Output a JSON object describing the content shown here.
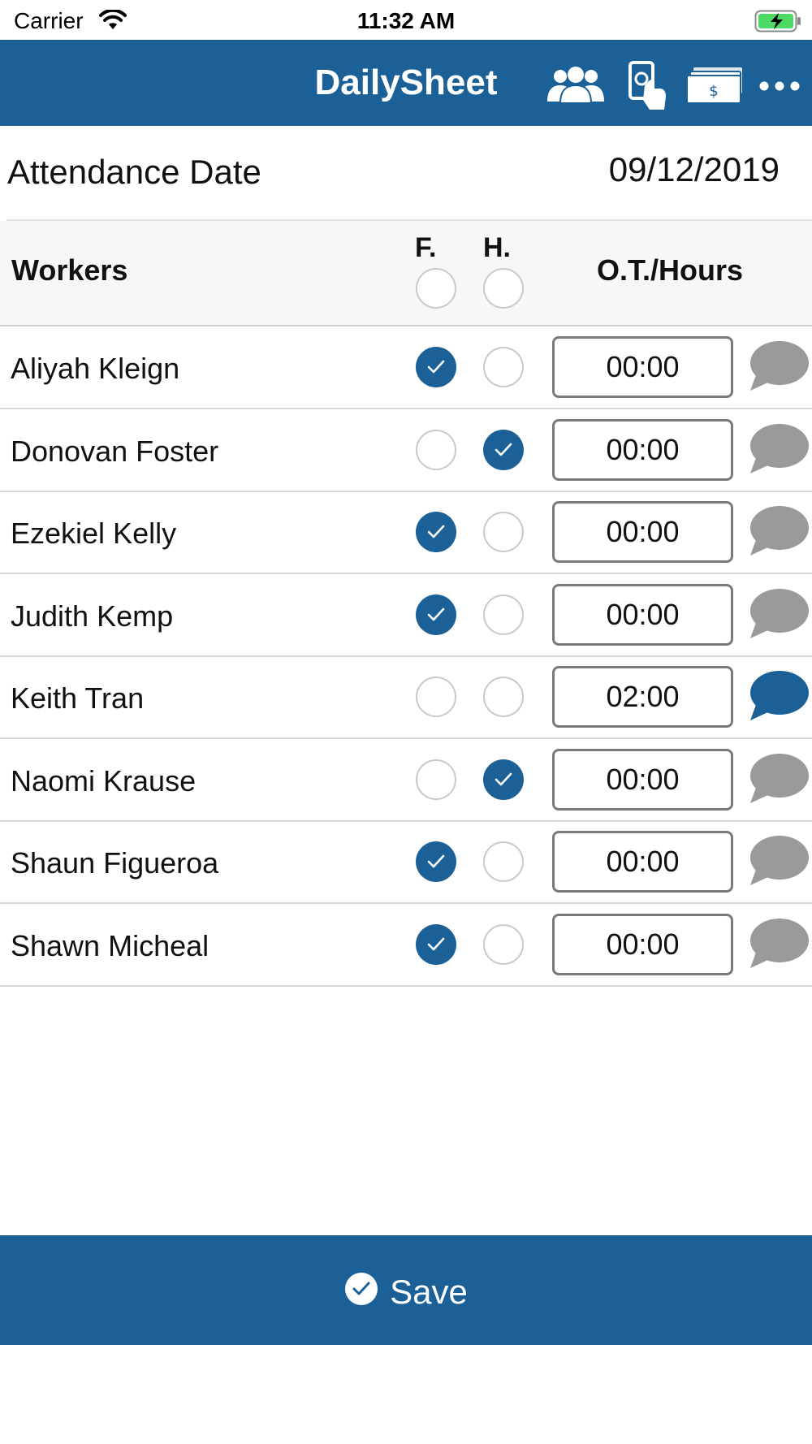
{
  "status_bar": {
    "carrier": "Carrier",
    "time": "11:32 AM"
  },
  "nav": {
    "title": "DailySheet",
    "icons": [
      "workers-group-icon",
      "mobile-payment-icon",
      "cash-icon",
      "more-icon"
    ]
  },
  "attendance": {
    "label": "Attendance Date",
    "date": "09/12/2019"
  },
  "table_header": {
    "workers": "Workers",
    "full": "F.",
    "half": "H.",
    "overtime": "O.T./Hours"
  },
  "workers": [
    {
      "name": "Aliyah Kleign",
      "full": true,
      "half": false,
      "hours": "00:00",
      "has_comment": false
    },
    {
      "name": "Donovan Foster",
      "full": false,
      "half": true,
      "hours": "00:00",
      "has_comment": false
    },
    {
      "name": "Ezekiel Kelly",
      "full": true,
      "half": false,
      "hours": "00:00",
      "has_comment": false
    },
    {
      "name": "Judith Kemp",
      "full": true,
      "half": false,
      "hours": "00:00",
      "has_comment": false
    },
    {
      "name": "Keith Tran",
      "full": false,
      "half": false,
      "hours": "02:00",
      "has_comment": true
    },
    {
      "name": "Naomi Krause",
      "full": false,
      "half": true,
      "hours": "00:00",
      "has_comment": false
    },
    {
      "name": "Shaun Figueroa",
      "full": true,
      "half": false,
      "hours": "00:00",
      "has_comment": false
    },
    {
      "name": "Shawn Micheal",
      "full": true,
      "half": false,
      "hours": "00:00",
      "has_comment": false
    }
  ],
  "save": {
    "label": "Save"
  },
  "colors": {
    "brand": "#1b6198",
    "comment_inactive": "#9a9a9a",
    "comment_active": "#1b6198",
    "radio_border": "#c9c9c9"
  }
}
